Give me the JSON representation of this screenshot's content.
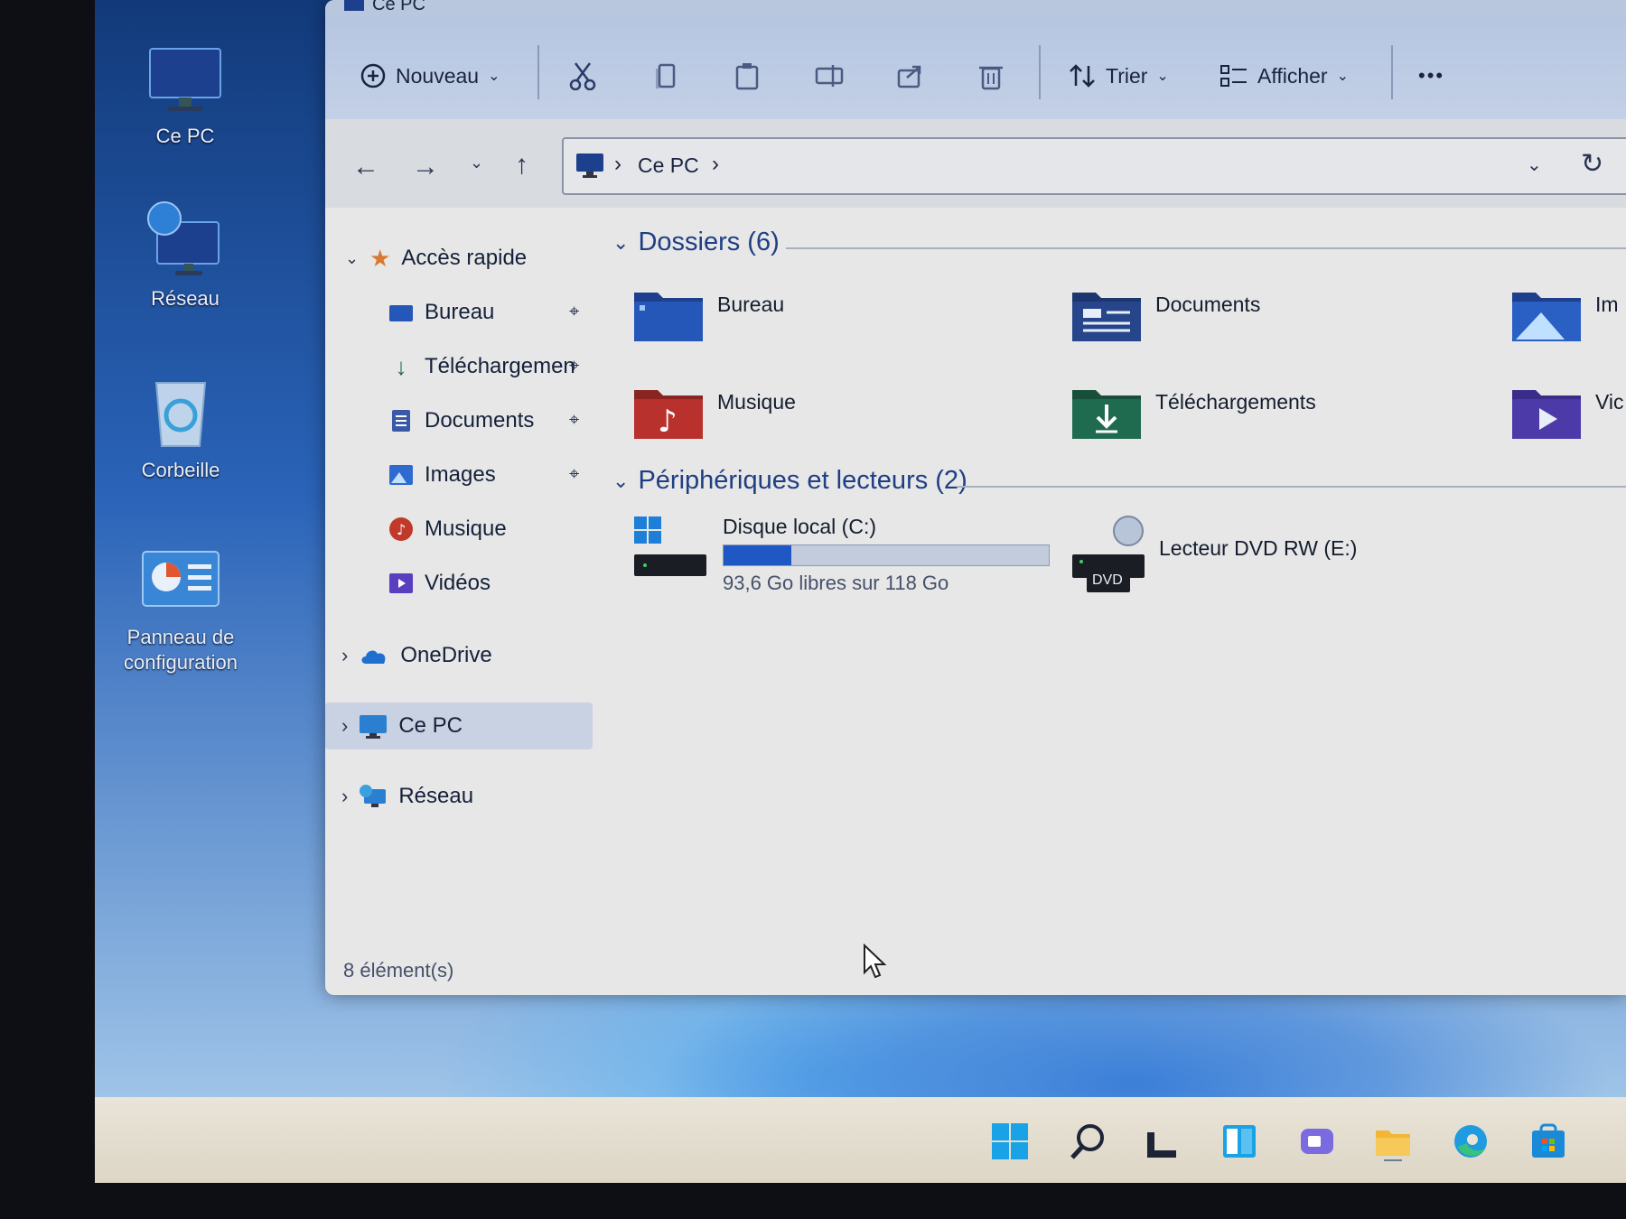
{
  "desktop": {
    "icons": [
      {
        "icon": "monitor-icon",
        "label": "Ce PC"
      },
      {
        "icon": "network-icon",
        "label": "Réseau"
      },
      {
        "icon": "recycle-bin-icon",
        "label": "Corbeille"
      },
      {
        "icon": "control-panel-icon",
        "label": "Panneau de configuration"
      }
    ]
  },
  "window": {
    "title": "Ce PC",
    "ribbon": {
      "new_label": "Nouveau",
      "sort_label": "Trier",
      "view_label": "Afficher",
      "more_label": "•••"
    },
    "address": {
      "path": [
        "Ce PC"
      ]
    },
    "sidebar": {
      "quick_access": "Accès rapide",
      "pinned": [
        {
          "icon": "desktop-folder-icon",
          "label": "Bureau"
        },
        {
          "icon": "download-icon",
          "label": "Téléchargemen"
        },
        {
          "icon": "documents-icon",
          "label": "Documents"
        },
        {
          "icon": "images-icon",
          "label": "Images"
        }
      ],
      "unpinned": [
        {
          "icon": "music-icon",
          "label": "Musique"
        },
        {
          "icon": "videos-icon",
          "label": "Vidéos"
        }
      ],
      "onedrive": "OneDrive",
      "this_pc": "Ce PC",
      "network": "Réseau"
    },
    "folders_header": "Dossiers (6)",
    "folders": [
      {
        "icon": "desktop-folder-icon",
        "label": "Bureau"
      },
      {
        "icon": "documents-folder-icon",
        "label": "Documents"
      },
      {
        "icon": "images-folder-icon",
        "label": "Im"
      },
      {
        "icon": "music-folder-icon",
        "label": "Musique"
      },
      {
        "icon": "downloads-folder-icon",
        "label": "Téléchargements"
      },
      {
        "icon": "videos-folder-icon",
        "label": "Vic"
      }
    ],
    "devices_header": "Périphériques et lecteurs (2)",
    "devices": [
      {
        "icon": "local-disk-icon",
        "label": "Disque local (C:)",
        "detail": "93,6 Go libres sur 118 Go",
        "used_fraction": 0.207
      },
      {
        "icon": "dvd-drive-icon",
        "label": "Lecteur DVD RW (E:)",
        "badge": "DVD"
      }
    ],
    "status": "8 élément(s)"
  },
  "taskbar": {
    "icons": [
      "windows-start-icon",
      "search-icon",
      "task-view-icon",
      "widgets-icon",
      "chat-icon",
      "file-explorer-icon",
      "edge-icon",
      "store-icon"
    ]
  },
  "colors": {
    "accent": "#1f4fa8",
    "folder_blue": "#2457b8",
    "folder_red": "#b8312c",
    "folder_green": "#1f6b4f",
    "folder_purple": "#4b3aa8"
  }
}
